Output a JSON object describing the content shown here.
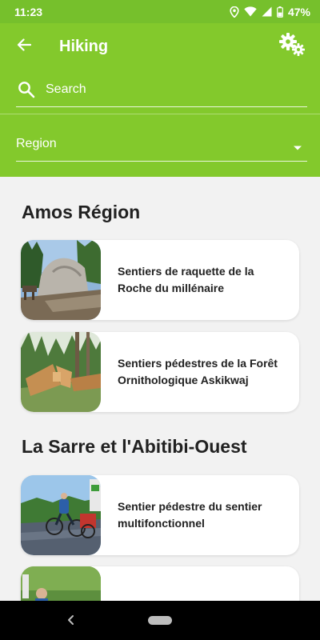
{
  "status_bar": {
    "time": "11:23",
    "battery": "47%",
    "icons": [
      "location-icon",
      "wifi-icon",
      "signal-icon",
      "battery-icon"
    ]
  },
  "header": {
    "title": "Hiking",
    "back_icon": "arrow-left-icon",
    "settings_icon": "gears-icon",
    "search": {
      "placeholder": "Search",
      "value": ""
    },
    "region_select": {
      "label": "Region"
    }
  },
  "colors": {
    "header_green": "#83c92c",
    "status_green": "#76c02c",
    "background": "#f2f2f2"
  },
  "sections": [
    {
      "title": "Amos Région",
      "items": [
        {
          "title": "Sentiers de raquette de la Roche du millénaire"
        },
        {
          "title": "Sentiers pédestres de la Forêt Ornithologique Askikwaj"
        }
      ]
    },
    {
      "title": "La Sarre et l'Abitibi-Ouest",
      "items": [
        {
          "title": "Sentier pédestre du sentier multifonctionnel"
        },
        {
          "title": ""
        }
      ]
    }
  ]
}
